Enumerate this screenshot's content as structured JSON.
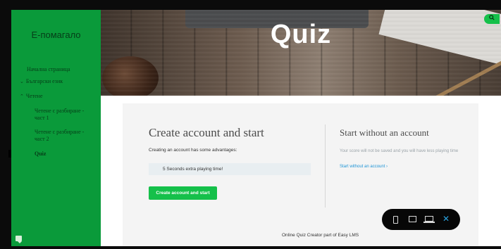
{
  "sidebar": {
    "title": "Е-помагало",
    "items": [
      {
        "label": "Начална страница",
        "chevron": ""
      },
      {
        "label": "Български език",
        "chevron": "⌄"
      },
      {
        "label": "Четене",
        "chevron": "⌃"
      },
      {
        "label": "Четене с разбиране - част 1",
        "chevron": ""
      },
      {
        "label": "Четене с разбиране - част 2",
        "chevron": ""
      },
      {
        "label": "Quiz",
        "chevron": ""
      }
    ]
  },
  "hero": {
    "title": "Quiz",
    "search_icon": "search-icon"
  },
  "card": {
    "left_title": "Create account and start",
    "left_sub": "Creating an account has some advantages:",
    "advantage": "5 Seconds extra playing time!",
    "primary_button": "Create account and start",
    "right_title": "Start without an account",
    "right_note": "Your score will not be saved and you will have less playing time",
    "right_link": "Start without an account ›"
  },
  "footer": {
    "text": "Online Quiz Creator part of Easy LMS"
  },
  "device_bar": {
    "icons": [
      "phone-icon",
      "tablet-icon",
      "laptop-icon",
      "close-icon"
    ],
    "close_glyph": "✕"
  },
  "colors": {
    "sidebar": "#0a9a3a",
    "accent_green": "#15c04a",
    "link_blue": "#1f95d6",
    "close_blue": "#2aa3e0"
  }
}
